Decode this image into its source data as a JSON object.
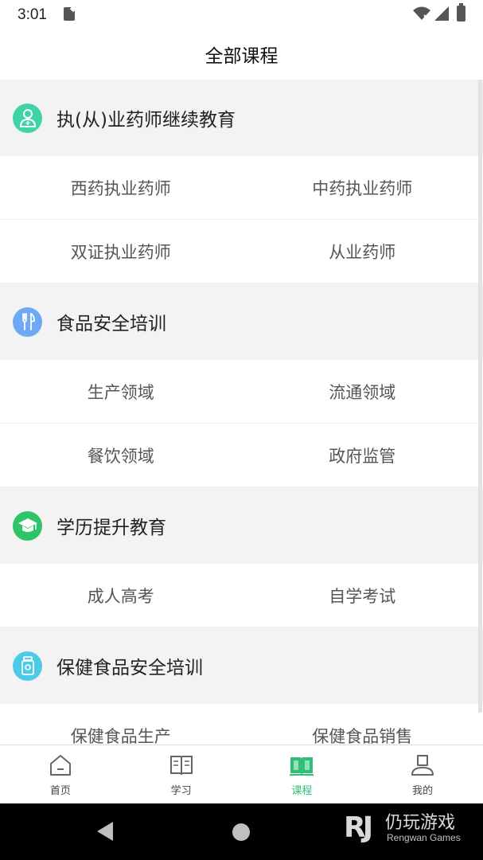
{
  "status_bar": {
    "time": "3:01"
  },
  "header": {
    "title": "全部课程"
  },
  "categories": [
    {
      "title": "执(从)业药师继续教育",
      "icon": "pharmacist-icon",
      "color": "#3fd3a6",
      "items": [
        "西药执业药师",
        "中药执业药师",
        "双证执业药师",
        "从业药师"
      ]
    },
    {
      "title": "食品安全培训",
      "icon": "fork-knife-icon",
      "color": "#6fa8f4",
      "items": [
        "生产领域",
        "流通领域",
        "餐饮领域",
        "政府监管"
      ]
    },
    {
      "title": "学历提升教育",
      "icon": "graduation-cap-icon",
      "color": "#2fc46a",
      "items": [
        "成人高考",
        "自学考试"
      ]
    },
    {
      "title": "保健食品安全培训",
      "icon": "health-food-icon",
      "color": "#4ccbe6",
      "items": [
        "保健食品生产",
        "保健食品销售"
      ]
    }
  ],
  "bottom_nav": [
    {
      "label": "首页",
      "icon": "home-icon",
      "active": false
    },
    {
      "label": "学习",
      "icon": "book-open-icon",
      "active": false
    },
    {
      "label": "课程",
      "icon": "course-book-icon",
      "active": true
    },
    {
      "label": "我的",
      "icon": "user-icon",
      "active": false
    }
  ],
  "watermark": {
    "brand_cn": "仍玩游戏",
    "brand_en": "Rengwan Games"
  },
  "colors": {
    "accent": "#2fbf77"
  }
}
